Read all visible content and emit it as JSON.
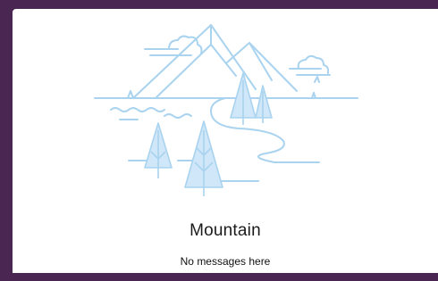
{
  "empty_state": {
    "title": "Mountain",
    "message": "No messages here",
    "illustration": "mountain-landscape-illustration"
  },
  "colors": {
    "frame": "#4a2752",
    "panel": "#ffffff",
    "line": "#a9d3ef",
    "fill": "#cfe7f8",
    "text": "#1b1b1b"
  }
}
